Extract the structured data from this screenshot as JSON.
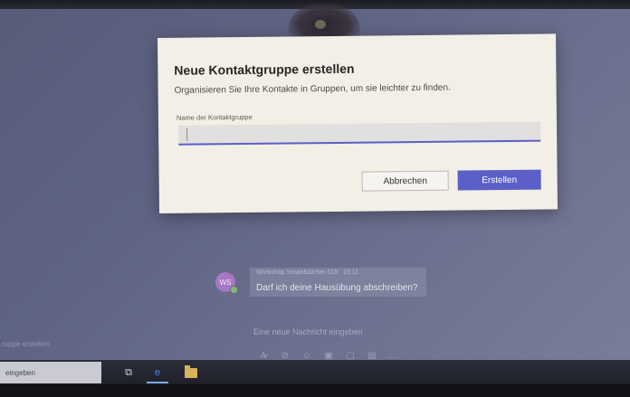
{
  "dialog": {
    "title": "Neue Kontaktgruppe erstellen",
    "description": "Organisieren Sie Ihre Kontakte in Gruppen, um sie leichter zu finden.",
    "field_label": "Name der Kontaktgruppe",
    "field_value": "",
    "cancel_label": "Abbrechen",
    "create_label": "Erstellen"
  },
  "chat": {
    "avatar_initials": "WS",
    "sender": "Workshop Smart&Sicher 018",
    "time": "15:11",
    "message": "Darf ich deine Hausübung abschreiben?",
    "compose_placeholder": "Eine neue Nachricht eingeben",
    "toolbar_icons": [
      "format-icon",
      "attach-icon",
      "emoji-icon",
      "gif-icon",
      "sticker-icon",
      "meet-icon",
      "more-icon"
    ]
  },
  "sidebar": {
    "partial_text": "ruppe erstellen"
  },
  "taskbar": {
    "search_text": "eingeben"
  },
  "colors": {
    "accent": "#5b5fc7",
    "dialog_bg": "#f2efe6",
    "screen_bg": "#5f6484"
  }
}
